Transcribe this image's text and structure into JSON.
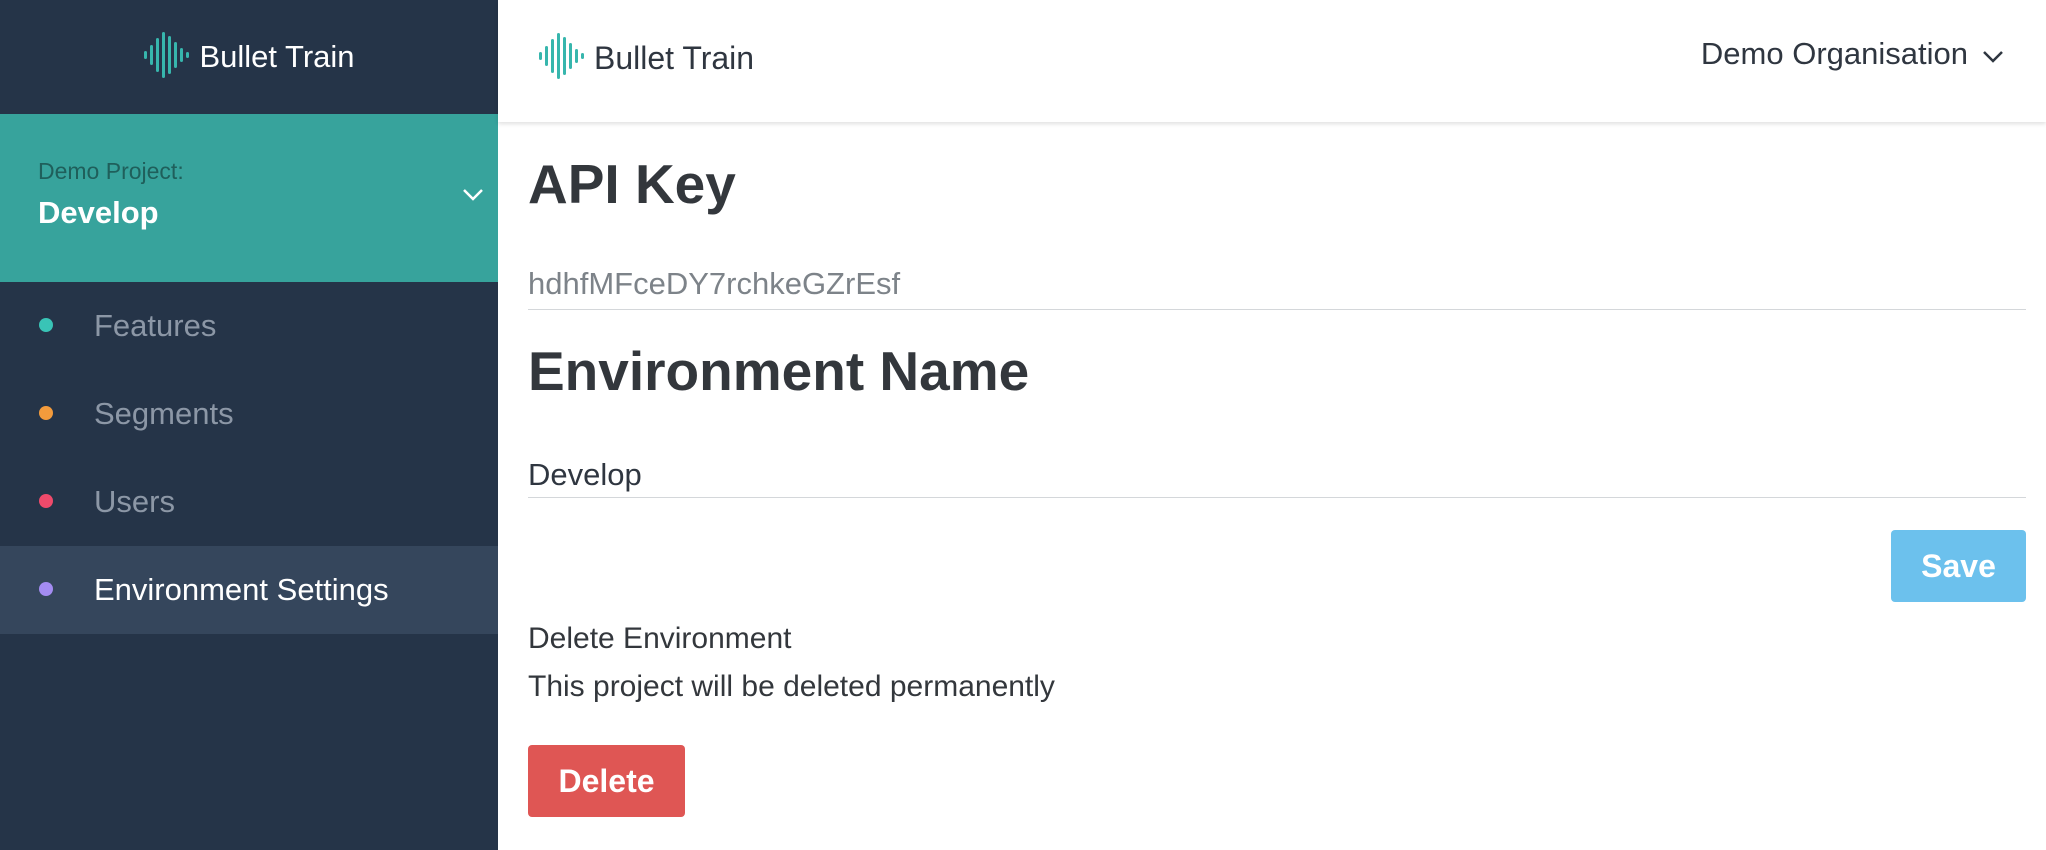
{
  "brand": {
    "name": "Bullet Train",
    "icon": "soundwave-logo-icon",
    "accent": "#37b6ad"
  },
  "sidebar": {
    "project_label": "Demo Project:",
    "environment": "Develop",
    "items": [
      {
        "label": "Features",
        "dot_color": "#39c4b6",
        "active": false
      },
      {
        "label": "Segments",
        "dot_color": "#f39b3c",
        "active": false
      },
      {
        "label": "Users",
        "dot_color": "#ef4a6b",
        "active": false
      },
      {
        "label": "Environment Settings",
        "dot_color": "#a48cf2",
        "active": true
      }
    ]
  },
  "header": {
    "organisation": "Demo Organisation"
  },
  "main": {
    "api_key_title": "API Key",
    "api_key_value": "hdhfMFceDY7rchkeGZrEsf",
    "env_name_title": "Environment Name",
    "env_name_value": "Develop",
    "save_label": "Save",
    "delete_title": "Delete Environment",
    "delete_description": "This project will be deleted permanently",
    "delete_label": "Delete"
  },
  "colors": {
    "sidebar_bg": "#253448",
    "project_bg": "#37a39c",
    "save": "#6cc1ed",
    "delete": "#df5654"
  }
}
